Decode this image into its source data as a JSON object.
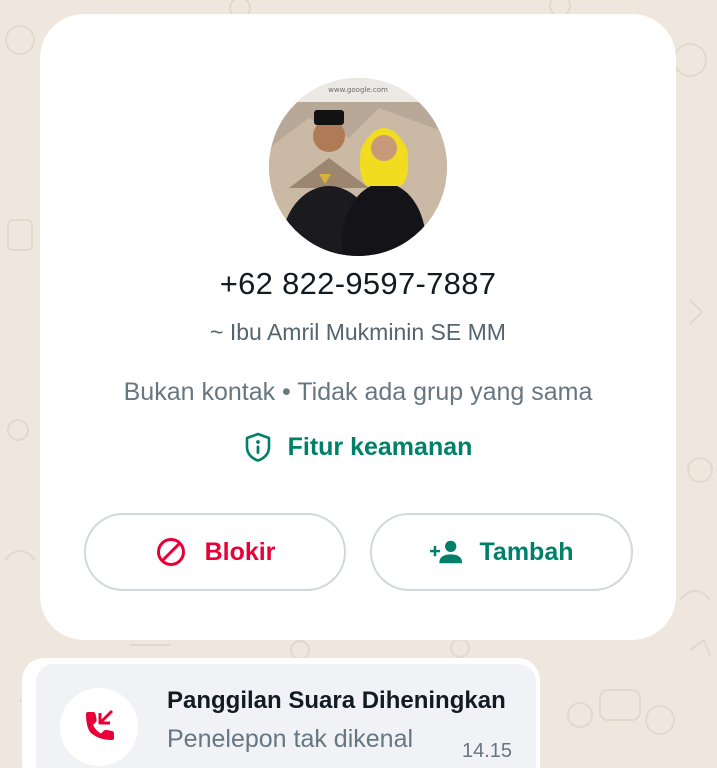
{
  "contact": {
    "phone": "+62 822-9597-7887",
    "push_name": "~ Ibu Amril Mukminin SE MM",
    "meta": "Bukan kontak • Tidak ada grup yang sama",
    "security_label": "Fitur keamanan",
    "avatar_watermark": "www.google.com"
  },
  "actions": {
    "block_label": "Blokir",
    "add_label": "Tambah"
  },
  "call": {
    "title": "Panggilan Suara Diheningkan",
    "subtitle": "Penelepon tak dikenal",
    "time": "14.15"
  },
  "colors": {
    "accent_green": "#008069",
    "block_red": "#ea0038",
    "missed_call_red": "#ea0038",
    "chat_background": "#efe7dd"
  },
  "icons": {
    "security": "shield-info-icon",
    "block": "block-icon",
    "add": "add-person-icon",
    "call": "missed-call-icon"
  }
}
